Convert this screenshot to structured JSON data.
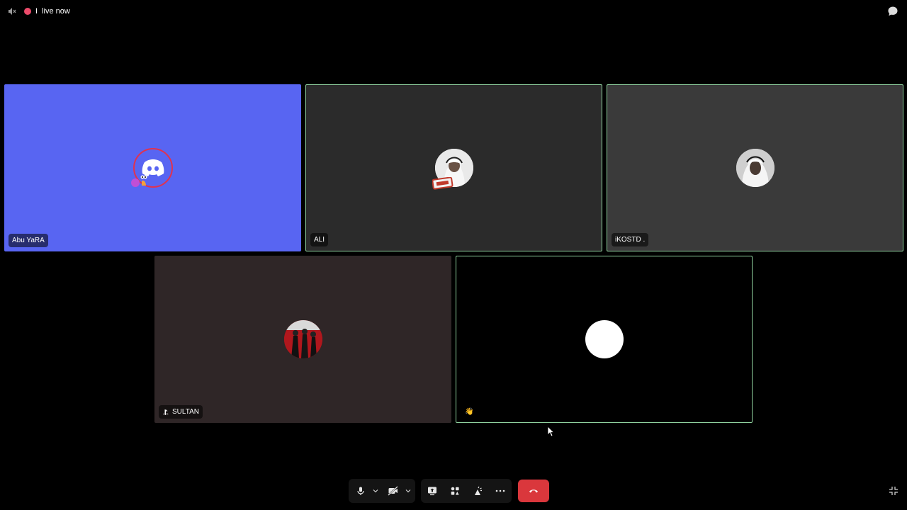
{
  "topbar": {
    "glyph": "I",
    "live_label": "live now",
    "live_color": "#ed4b6b"
  },
  "participants": [
    {
      "name": "Abu YaRA",
      "bg": "#5865f2",
      "speaking": false,
      "avatar": "discord-snail-avatar"
    },
    {
      "name": "ALI",
      "bg": "#2b2b2b",
      "speaking": true,
      "avatar": "photo-avatar"
    },
    {
      "name": "iKOSTD .",
      "bg": "#3a3a3a",
      "speaking": true,
      "avatar": "photo-avatar"
    },
    {
      "name": "SULTAN",
      "bg": "#2f2627",
      "speaking": false,
      "avatar": "photo-avatar",
      "prefix_icon": "playstation-icon"
    },
    {
      "name": "",
      "bg": "#000000",
      "speaking": true,
      "avatar": "white-circle-avatar",
      "reaction": "👋"
    }
  ],
  "controls": {
    "icons": [
      "microphone-icon",
      "chevron-down-icon",
      "camera-off-icon",
      "chevron-down-icon",
      "screen-share-icon",
      "activities-icon",
      "soundboard-icon",
      "more-icon",
      "hang-up-icon"
    ],
    "hangup_color": "#da373c"
  }
}
